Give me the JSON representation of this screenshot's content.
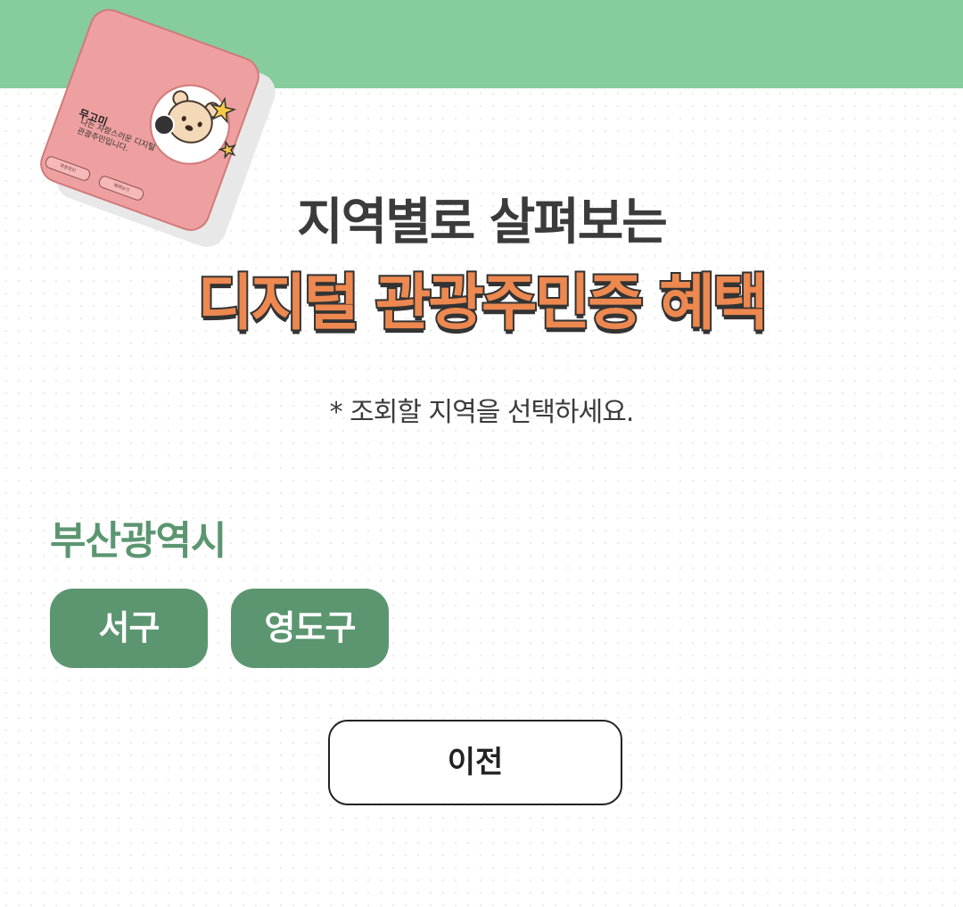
{
  "header": {
    "band_color": "#86cc9d"
  },
  "card": {
    "name": "무고미",
    "description": "나는 자랑스러운 디지털 관광주민입니다.",
    "button_1": "회원정보",
    "button_2": "혜택보기",
    "card_color": "#eea0a0",
    "character_icon": "bear-icon",
    "star_icon": "star-icon"
  },
  "title": {
    "line1": "지역별로 살펴보는",
    "line2": "디지털 관광주민증 혜택",
    "highlight_color": "#ec8850"
  },
  "instruction": "* 조회할 지역을 선택하세요.",
  "region": {
    "name": "부산광역시",
    "color": "#5b9670",
    "districts": [
      {
        "label": "서구"
      },
      {
        "label": "영도구"
      }
    ]
  },
  "navigation": {
    "prev_label": "이전"
  }
}
